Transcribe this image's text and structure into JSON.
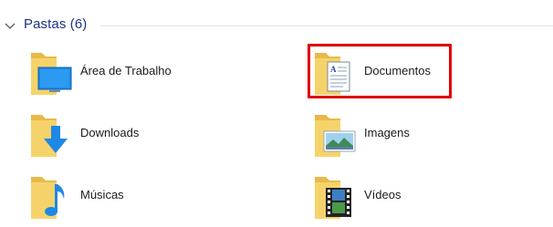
{
  "section": {
    "title": "Pastas (6)"
  },
  "folders": [
    {
      "label": "Área de Trabalho",
      "icon": "desktop-folder-icon"
    },
    {
      "label": "Documentos",
      "icon": "documents-folder-icon"
    },
    {
      "label": "Downloads",
      "icon": "downloads-folder-icon"
    },
    {
      "label": "Imagens",
      "icon": "pictures-folder-icon"
    },
    {
      "label": "Músicas",
      "icon": "music-folder-icon"
    },
    {
      "label": "Vídeos",
      "icon": "videos-folder-icon"
    }
  ],
  "highlight": {
    "target": "Documentos",
    "color": "#e00000"
  },
  "colors": {
    "folder": "#f6d36a",
    "folder_dark": "#e8b94a",
    "header_text": "#1e3287",
    "accent_blue": "#1e88e5"
  }
}
